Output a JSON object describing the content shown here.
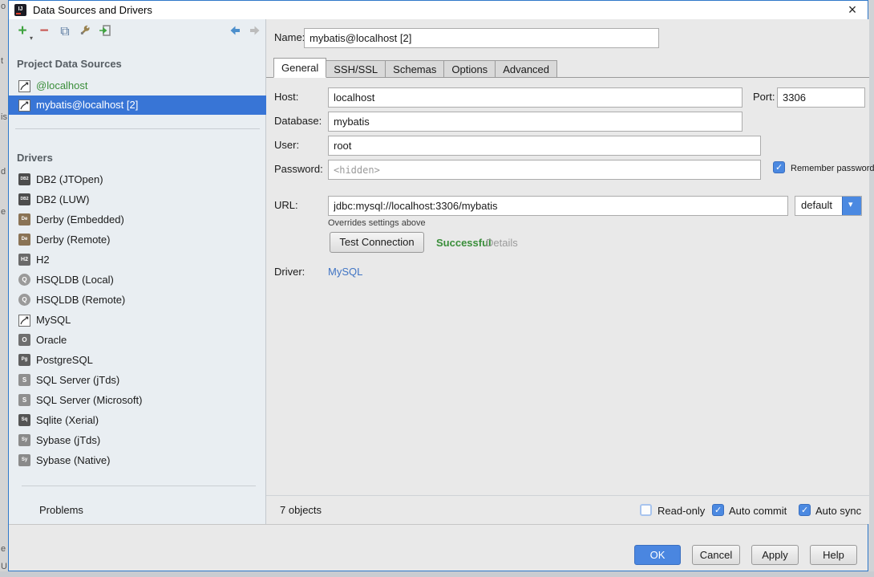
{
  "window": {
    "title": "Data Sources and Drivers",
    "app_icon": "intellij-logo-icon",
    "close_icon": "close-x-icon"
  },
  "toolbar": {
    "icons": [
      "add-icon",
      "remove-icon",
      "duplicate-icon",
      "properties-wrench-icon",
      "import-icon"
    ],
    "nav_icons": [
      "back-arrow-icon",
      "forward-arrow-icon"
    ]
  },
  "sidebar": {
    "project_header": "Project Data Sources",
    "project_items": [
      {
        "label": "@localhost",
        "icon": "mysql-icon",
        "selected": false
      },
      {
        "label": "mybatis@localhost [2]",
        "icon": "mysql-icon",
        "selected": true
      }
    ],
    "drivers_header": "Drivers",
    "driver_items": [
      {
        "label": "DB2 (JTOpen)",
        "icon": "db2-icon",
        "glyph": "DB2"
      },
      {
        "label": "DB2 (LUW)",
        "icon": "db2-icon",
        "glyph": "DB2"
      },
      {
        "label": "Derby (Embedded)",
        "icon": "derby-icon",
        "glyph": "De"
      },
      {
        "label": "Derby (Remote)",
        "icon": "derby-icon",
        "glyph": "De"
      },
      {
        "label": "H2",
        "icon": "h2-icon",
        "glyph": "H2"
      },
      {
        "label": "HSQLDB (Local)",
        "icon": "hsqldb-icon",
        "glyph": "Q"
      },
      {
        "label": "HSQLDB (Remote)",
        "icon": "hsqldb-icon",
        "glyph": "Q"
      },
      {
        "label": "MySQL",
        "icon": "mysql-icon",
        "glyph": ""
      },
      {
        "label": "Oracle",
        "icon": "oracle-icon",
        "glyph": "O"
      },
      {
        "label": "PostgreSQL",
        "icon": "postgresql-icon",
        "glyph": "Pg"
      },
      {
        "label": "SQL Server (jTds)",
        "icon": "sqlserver-icon",
        "glyph": "S"
      },
      {
        "label": "SQL Server (Microsoft)",
        "icon": "sqlserver-icon",
        "glyph": "S"
      },
      {
        "label": "Sqlite (Xerial)",
        "icon": "sqlite-icon",
        "glyph": "Sq"
      },
      {
        "label": "Sybase (jTds)",
        "icon": "sybase-icon",
        "glyph": "Sy"
      },
      {
        "label": "Sybase (Native)",
        "icon": "sybase-icon",
        "glyph": "Sy"
      }
    ],
    "problems_label": "Problems"
  },
  "form": {
    "name": {
      "label": "Name:",
      "value": "mybatis@localhost [2]"
    },
    "tabs": [
      {
        "label": "General",
        "active": true
      },
      {
        "label": "SSH/SSL",
        "active": false
      },
      {
        "label": "Schemas",
        "active": false
      },
      {
        "label": "Options",
        "active": false
      },
      {
        "label": "Advanced",
        "active": false
      }
    ],
    "host": {
      "label": "Host:",
      "value": "localhost"
    },
    "port": {
      "label": "Port:",
      "value": "3306"
    },
    "database": {
      "label": "Database:",
      "value": "mybatis"
    },
    "user": {
      "label": "User:",
      "value": "root"
    },
    "password": {
      "label": "Password:",
      "placeholder": "<hidden>"
    },
    "remember_password": {
      "label": "Remember password",
      "checked": true
    },
    "url": {
      "label": "URL:",
      "value": "jdbc:mysql://localhost:3306/mybatis"
    },
    "url_preset": {
      "value": "default"
    },
    "overrides_note": "Overrides settings above",
    "test_connection": {
      "button_label": "Test Connection",
      "status": "Successful",
      "details_label": "Details"
    },
    "driver": {
      "label": "Driver:",
      "value": "MySQL"
    }
  },
  "statusbar": {
    "objects_count": "7 objects",
    "read_only": {
      "label": "Read-only",
      "checked": false
    },
    "auto_commit": {
      "label": "Auto commit",
      "checked": true
    },
    "auto_sync": {
      "label": "Auto sync",
      "checked": true
    }
  },
  "dialog_buttons": {
    "ok": "OK",
    "cancel": "Cancel",
    "apply": "Apply",
    "help": "Help"
  },
  "edge_fragments": {
    "f0": "o",
    "f1": "t",
    "f2": "is",
    "f3": "d",
    "f4": "e",
    "f5": "e",
    "f6": "U"
  },
  "colors": {
    "selection_blue": "#3875d6",
    "checkbox_blue": "#4b89e1",
    "ok_button_blue": "#4a86e0",
    "datasource_green": "#3a8e3a",
    "success_green": "#3a8e3a",
    "link_blue": "#4175c4",
    "dialog_border_blue": "#2f78c9",
    "left_panel_bg": "#e9eef2",
    "right_panel_bg": "#e9e9e9"
  }
}
